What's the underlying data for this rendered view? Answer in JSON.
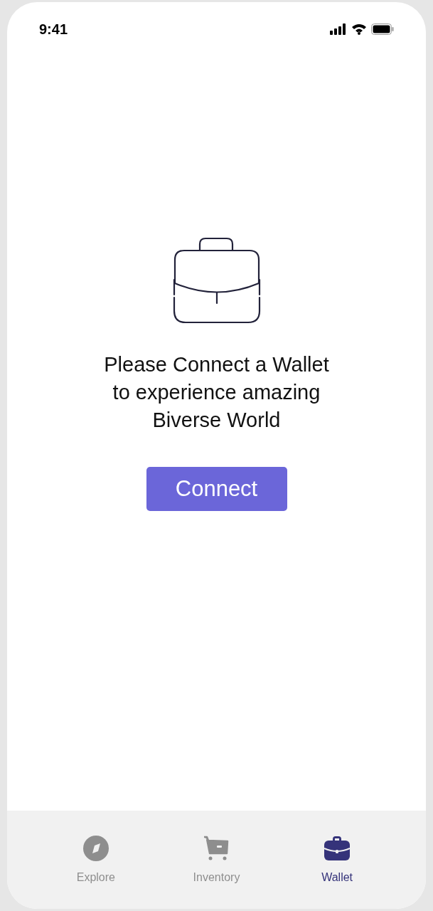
{
  "status_bar": {
    "time": "9:41"
  },
  "message": {
    "lines": [
      "Please Connect a Wallet",
      "to experience amazing",
      "Biverse World"
    ]
  },
  "connect_button": {
    "label": "Connect"
  },
  "tab_bar": [
    {
      "label": "Explore",
      "kind": "compass",
      "selected": false
    },
    {
      "label": "Inventory",
      "kind": "cart",
      "selected": false
    },
    {
      "label": "Wallet",
      "kind": "briefcase",
      "selected": true
    }
  ]
}
